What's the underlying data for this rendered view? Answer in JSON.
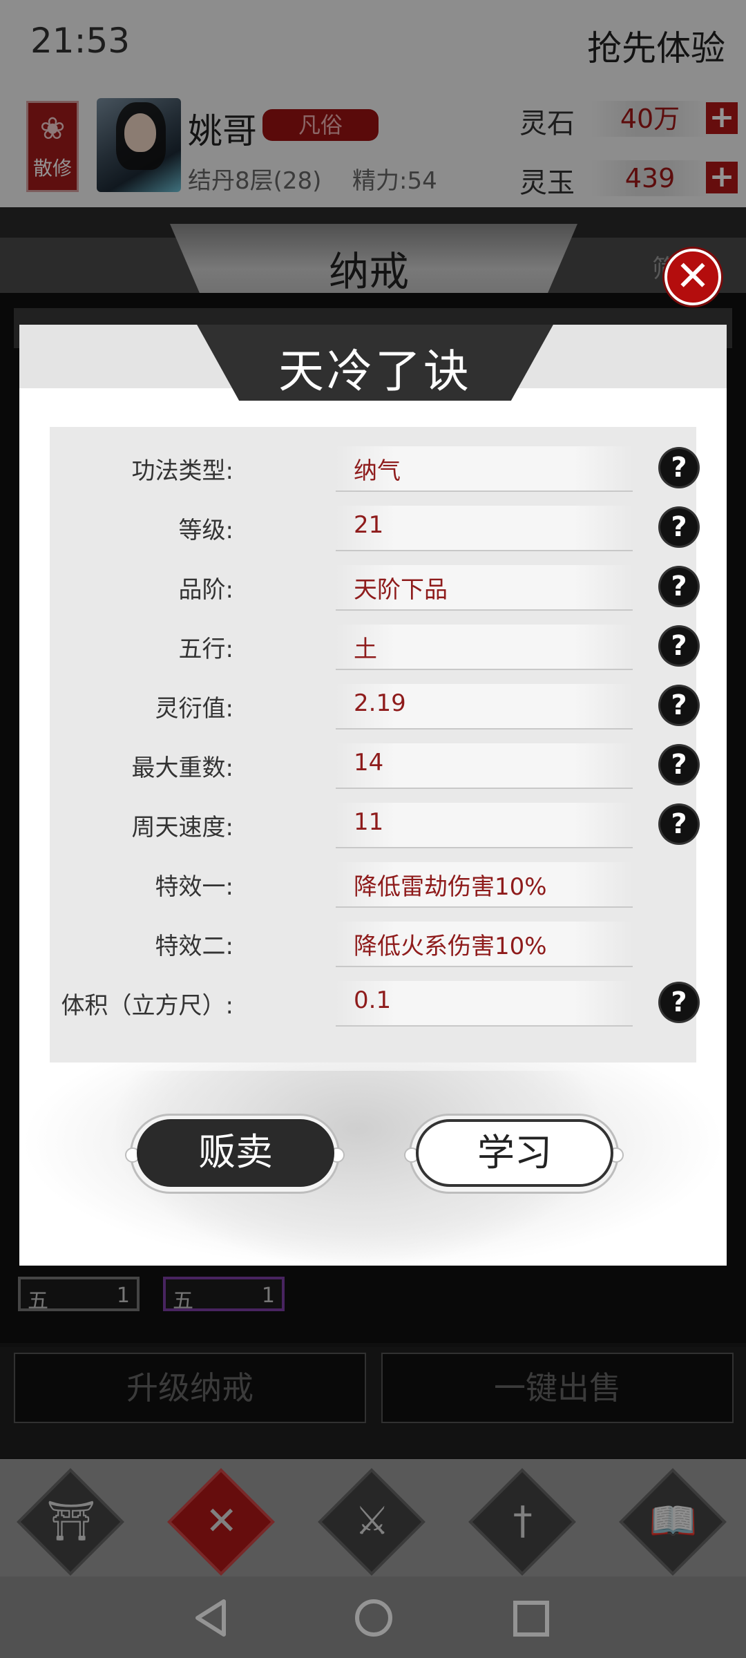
{
  "status_bar": {
    "time": "21:53"
  },
  "header": {
    "early_access": "抢先体验",
    "sect_badge": "散修",
    "player_name": "姚哥",
    "rank": "凡俗",
    "realm": "结丹8层(28)",
    "energy": "精力:54",
    "resources": [
      {
        "label": "灵石",
        "value": "40万"
      },
      {
        "label": "灵玉",
        "value": "439"
      }
    ]
  },
  "bag": {
    "title": "纳戒",
    "filter_label": "筛",
    "slots": [
      {
        "element": "五",
        "count": "1",
        "color": "#777777"
      },
      {
        "element": "五",
        "count": "1",
        "color": "#7d3fa6"
      }
    ],
    "actions": {
      "upgrade": "升级纳戒",
      "sell_all": "一键出售"
    }
  },
  "nav": {
    "items": [
      {
        "label": "洞府",
        "icon": "gate-icon",
        "glyph": "⛩",
        "active": false
      },
      {
        "label": "纳戒",
        "icon": "ring-icon",
        "glyph": "✕",
        "active": true
      },
      {
        "label": "历练",
        "icon": "crossed-swords-icon",
        "glyph": "⚔",
        "active": false
      },
      {
        "label": "装备",
        "icon": "sword-icon",
        "glyph": "†",
        "active": false
      },
      {
        "label": "参悟",
        "icon": "book-icon",
        "glyph": "📖",
        "active": false
      }
    ]
  },
  "modal": {
    "title": "天冷了诀",
    "attributes": [
      {
        "label": "功法类型:",
        "value": "纳气",
        "help": true
      },
      {
        "label": "等级:",
        "value": "21",
        "help": true
      },
      {
        "label": "品阶:",
        "value": "天阶下品",
        "help": true
      },
      {
        "label": "五行:",
        "value": "土",
        "help": true
      },
      {
        "label": "灵衍值:",
        "value": "2.19",
        "help": true
      },
      {
        "label": "最大重数:",
        "value": "14",
        "help": true
      },
      {
        "label": "周天速度:",
        "value": "11",
        "help": true
      },
      {
        "label": "特效一:",
        "value": "降低雷劫伤害10%",
        "help": false
      },
      {
        "label": "特效二:",
        "value": "降低火系伤害10%",
        "help": false
      },
      {
        "label": "体积（立方尺）:",
        "value": "0.1",
        "help": true
      }
    ],
    "help_glyph": "?",
    "sell_label": "贩卖",
    "learn_label": "学习",
    "close_glyph": "✕"
  },
  "colors": {
    "accent_red": "#b01717",
    "value_red": "#8e1b1b",
    "dark": "#2a2a2a"
  }
}
